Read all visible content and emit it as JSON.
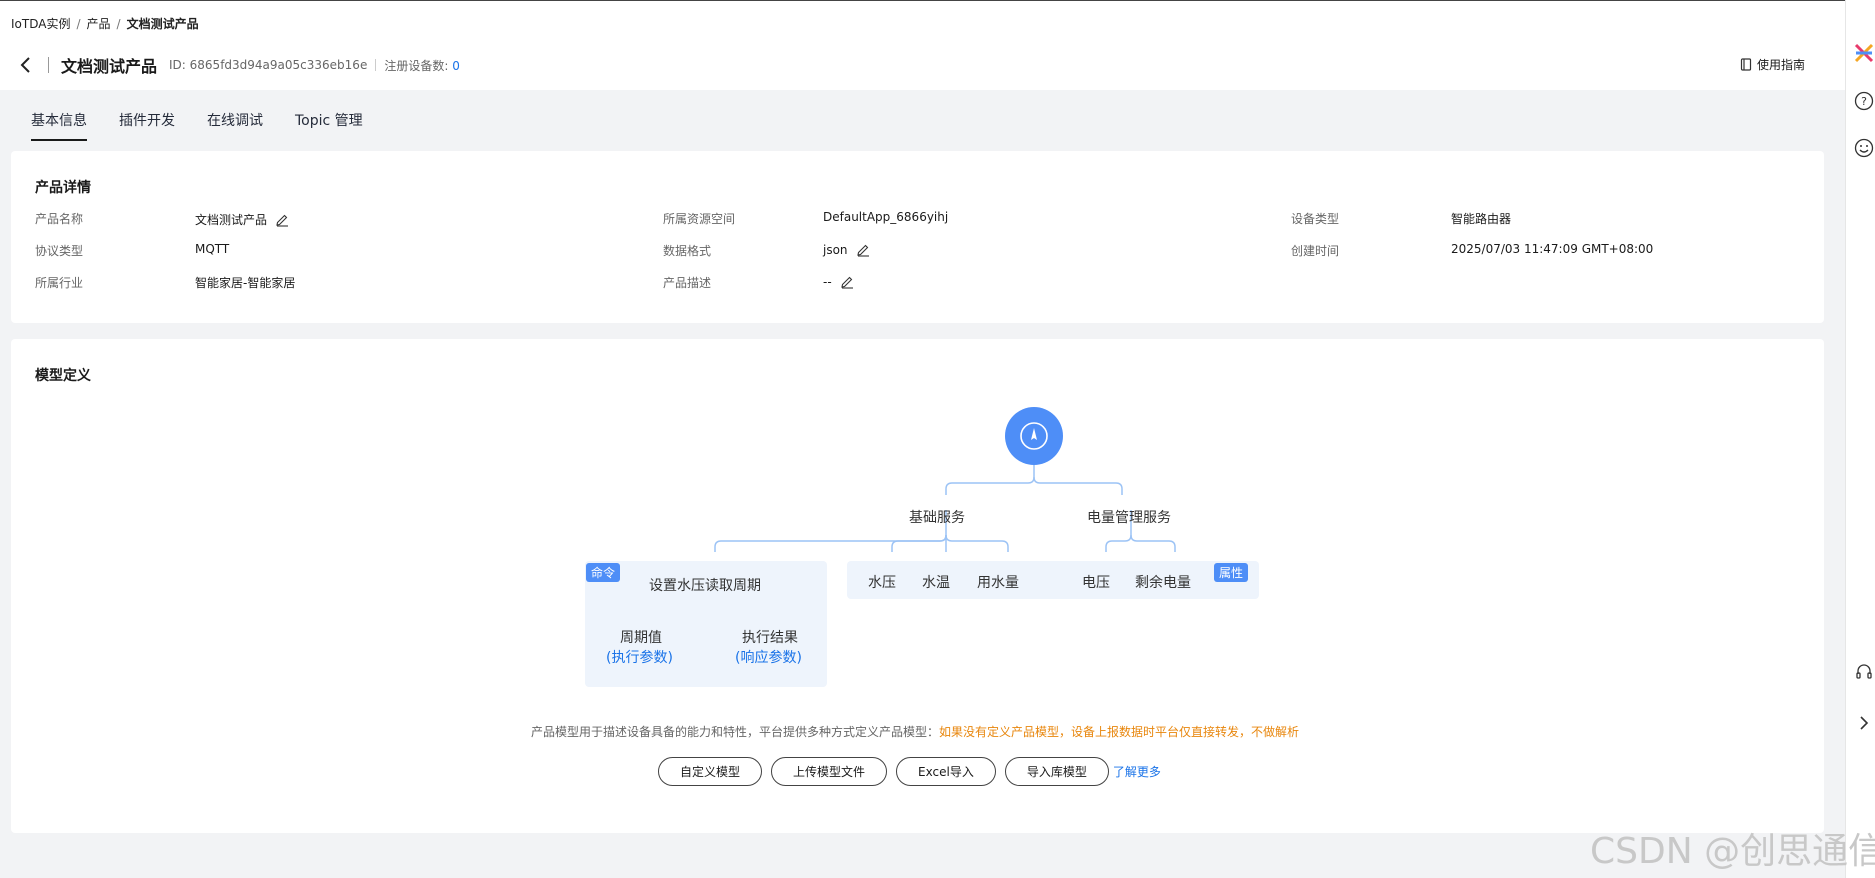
{
  "breadcrumb": {
    "items": [
      "IoTDA实例",
      "产品",
      "文档测试产品"
    ]
  },
  "header": {
    "title": "文档测试产品",
    "id_text": "ID: 6865fd3d94a9a05c336eb16e",
    "device_count_label": "注册设备数:",
    "device_count": "0",
    "guide_label": "使用指南"
  },
  "tabs": [
    {
      "label": "基本信息"
    },
    {
      "label": "插件开发"
    },
    {
      "label": "在线调试"
    },
    {
      "label": "Topic 管理"
    }
  ],
  "details": {
    "title": "产品详情",
    "fields": [
      {
        "label": "产品名称",
        "value": "文档测试产品"
      },
      {
        "label": "所属资源空间",
        "value": "DefaultApp_6866yihj"
      },
      {
        "label": "设备类型",
        "value": "智能路由器"
      },
      {
        "label": "协议类型",
        "value": "MQTT"
      },
      {
        "label": "数据格式",
        "value": "json"
      },
      {
        "label": "创建时间",
        "value": "2025/07/03 11:47:09 GMT+08:00"
      },
      {
        "label": "所属行业",
        "value": "智能家居-智能家居"
      },
      {
        "label": "产品描述",
        "value": "--"
      }
    ]
  },
  "model": {
    "title": "模型定义",
    "services": [
      "基础服务",
      "电量管理服务"
    ],
    "command_tag": "命令",
    "property_tag": "属性",
    "command": "设置水压读取周期",
    "command_params": [
      {
        "name": "周期值",
        "type": "(执行参数)"
      },
      {
        "name": "执行结果",
        "type": "(响应参数)"
      }
    ],
    "properties": [
      "水压",
      "水温",
      "用水量",
      "电压",
      "剩余电量"
    ],
    "description": "产品模型用于描述设备具备的能力和特性，平台提供多种方式定义产品模型：",
    "warning": "如果没有定义产品模型，设备上报数据时平台仅直接转发，不做解析",
    "buttons": [
      "自定义模型",
      "上传模型文件",
      "Excel导入",
      "导入库模型"
    ],
    "learn_more": "了解更多"
  },
  "watermark": "CSDN @创思通信",
  "icons": {
    "back": "chevron-left-icon",
    "edit": "edit-icon",
    "guide": "book-icon",
    "root": "compass-icon",
    "rail": [
      "brand-logo-icon",
      "help-icon",
      "smile-icon",
      "headset-icon",
      "chevron-right-icon"
    ]
  },
  "colors": {
    "accent": "#4e8ef7",
    "link": "#1a73e8",
    "warning": "#e8860c"
  }
}
